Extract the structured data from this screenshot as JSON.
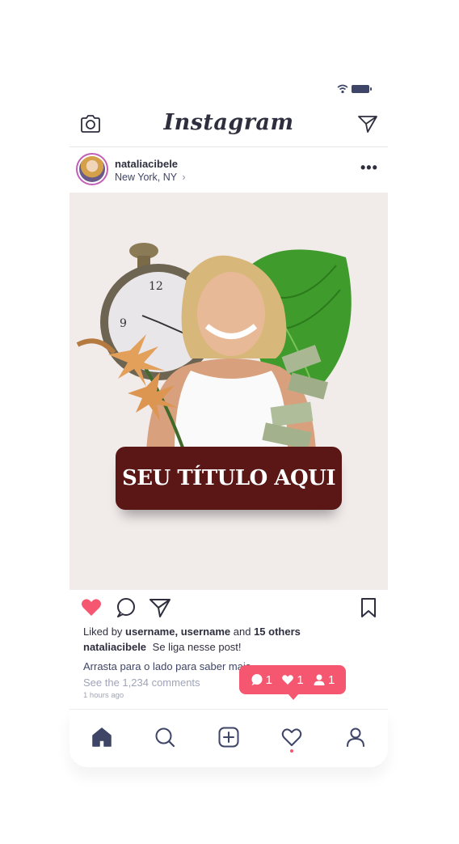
{
  "app": {
    "title": "Instagram"
  },
  "post": {
    "username": "nataliacibele",
    "location": "New York, NY",
    "location_chevron": "›",
    "more": "•••",
    "title_overlay": "SEU TÍTULO AQUI",
    "liked_by_prefix": "Liked by",
    "liked_by_users": "username, username",
    "liked_by_and": "and",
    "liked_by_others": "15 others",
    "caption_user": "nataliacibele",
    "caption_text": "Se liga nesse post!",
    "caption_line2": "Arrasta para o lado para saber mais",
    "comments_link": "See the 1,234 comments",
    "time_ago": "1 hours ago"
  },
  "notification": {
    "comments": "1",
    "likes": "1",
    "followers": "1"
  },
  "colors": {
    "accent": "#f4576f",
    "ink": "#2e2e3e",
    "title_box": "#5b1616",
    "avatar_ring": "#c25fb7"
  },
  "icons": {
    "top": [
      "camera-icon",
      "send-icon"
    ],
    "actions": [
      "heart-filled-icon",
      "comment-icon",
      "share-icon",
      "bookmark-icon"
    ],
    "nav": [
      "home-icon",
      "search-icon",
      "add-icon",
      "heart-icon",
      "profile-icon"
    ]
  }
}
